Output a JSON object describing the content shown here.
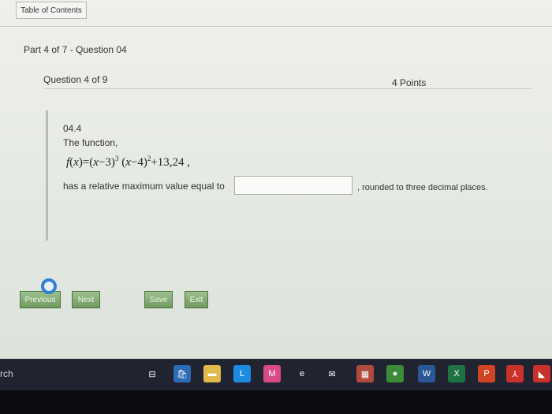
{
  "toolbar": {
    "toc_label": "Table of Contents"
  },
  "header": {
    "part_label": "Part 4 of 7 - Question 04"
  },
  "question": {
    "counter": "Question 4 of 9",
    "points": "4 Points",
    "number": "04.4",
    "prompt": "The function,",
    "formula": {
      "fx": "f",
      "lhs_open": "(",
      "var": "x",
      "lhs_close": ")=(",
      "t1_var": "x",
      "t1_rest": "−3)",
      "t1_exp": "3",
      "t2_open": " (",
      "t2_var": "x",
      "t2_rest": "−4)",
      "t2_exp": "2",
      "tail": "+13,24 ,"
    },
    "sentence_pre": "has a relative maximum value equal to",
    "answer_value": "",
    "sentence_post": ", rounded to three decimal places."
  },
  "nav": {
    "previous": "Previous",
    "next": "Next",
    "save": "Save",
    "exit": "Exit"
  },
  "taskbar": {
    "search_tail": "rch",
    "icons": [
      {
        "name": "task-view-icon",
        "glyph": "⊟",
        "color": "#1f2430"
      },
      {
        "name": "store-icon",
        "glyph": "🛍",
        "color": "#2d6bb5"
      },
      {
        "name": "file-explorer-icon",
        "glyph": "▬",
        "color": "#e0b94a"
      },
      {
        "name": "l-app-icon",
        "glyph": "L",
        "color": "#1e8be0"
      },
      {
        "name": "m-app-icon",
        "glyph": "M",
        "color": "#d84a8a"
      },
      {
        "name": "edge-icon",
        "glyph": "e",
        "color": "#1f2430"
      },
      {
        "name": "mail-icon",
        "glyph": "✉",
        "color": "#1f2430"
      },
      {
        "name": "calculator-icon",
        "glyph": "▦",
        "color": "#b04a3e"
      },
      {
        "name": "chrome-icon",
        "glyph": "●",
        "color": "#3c8a3a"
      },
      {
        "name": "word-icon",
        "glyph": "W",
        "color": "#2b5797"
      },
      {
        "name": "excel-icon",
        "glyph": "X",
        "color": "#1f7244"
      },
      {
        "name": "powerpoint-icon",
        "glyph": "P",
        "color": "#d04423"
      },
      {
        "name": "acrobat-icon",
        "glyph": "⅄",
        "color": "#c8322b"
      },
      {
        "name": "red-app-icon",
        "glyph": "◣",
        "color": "#c8322b"
      }
    ]
  }
}
